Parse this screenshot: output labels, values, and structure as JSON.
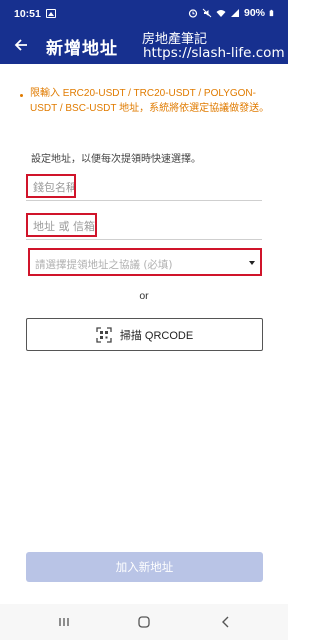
{
  "status_bar": {
    "time": "10:51",
    "battery": "90%"
  },
  "app_bar": {
    "title": "新增地址",
    "watermark_line1": "房地產筆記",
    "watermark_line2": "https://slash-life.com"
  },
  "notice": {
    "text": "限輸入 ERC20-USDT / TRC20-USDT / POLYGON-USDT / BSC-USDT 地址，系統將依選定協議做發送。"
  },
  "form": {
    "hint": "設定地址，以便每次提領時快速選擇。",
    "wallet_name_placeholder": "錢包名稱",
    "address_placeholder": "地址 或 信箱",
    "protocol_placeholder": "請選擇提領地址之協議 (必填)",
    "or_label": "or",
    "scan_qr_label": "掃描 QRCODE",
    "submit_label": "加入新地址"
  },
  "colors": {
    "primary": "#17308f",
    "notice": "#e07b00",
    "highlight_border": "#d0142a",
    "submit_disabled": "#b9c4e6"
  }
}
